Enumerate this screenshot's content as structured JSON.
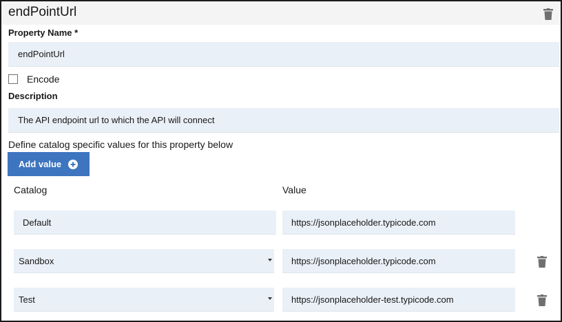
{
  "header": {
    "title": "endPointUrl",
    "delete_icon": "trash-icon"
  },
  "property_name": {
    "label": "Property Name *",
    "value": "endPointUrl"
  },
  "encode": {
    "label": "Encode",
    "checked": false
  },
  "description": {
    "label": "Description",
    "value": "The API endpoint url to which the API will connect"
  },
  "catalog_section": {
    "intro": "Define catalog specific values for this property below",
    "add_button_label": "Add value",
    "add_icon": "plus-circle-icon",
    "columns": {
      "catalog": "Catalog",
      "value": "Value"
    },
    "rows": [
      {
        "catalog": "Default",
        "value": "https://jsonplaceholder.typicode.com",
        "dropdown": false,
        "deletable": false
      },
      {
        "catalog": "Sandbox",
        "value": "https://jsonplaceholder.typicode.com",
        "dropdown": true,
        "deletable": true
      },
      {
        "catalog": "Test",
        "value": "https://jsonplaceholder-test.typicode.com",
        "dropdown": true,
        "deletable": true
      }
    ]
  },
  "colors": {
    "accent": "#3e75bf",
    "field_bg": "#eaf0f7",
    "header_bg": "#f4f4f4",
    "icon": "#6f6f6f"
  }
}
